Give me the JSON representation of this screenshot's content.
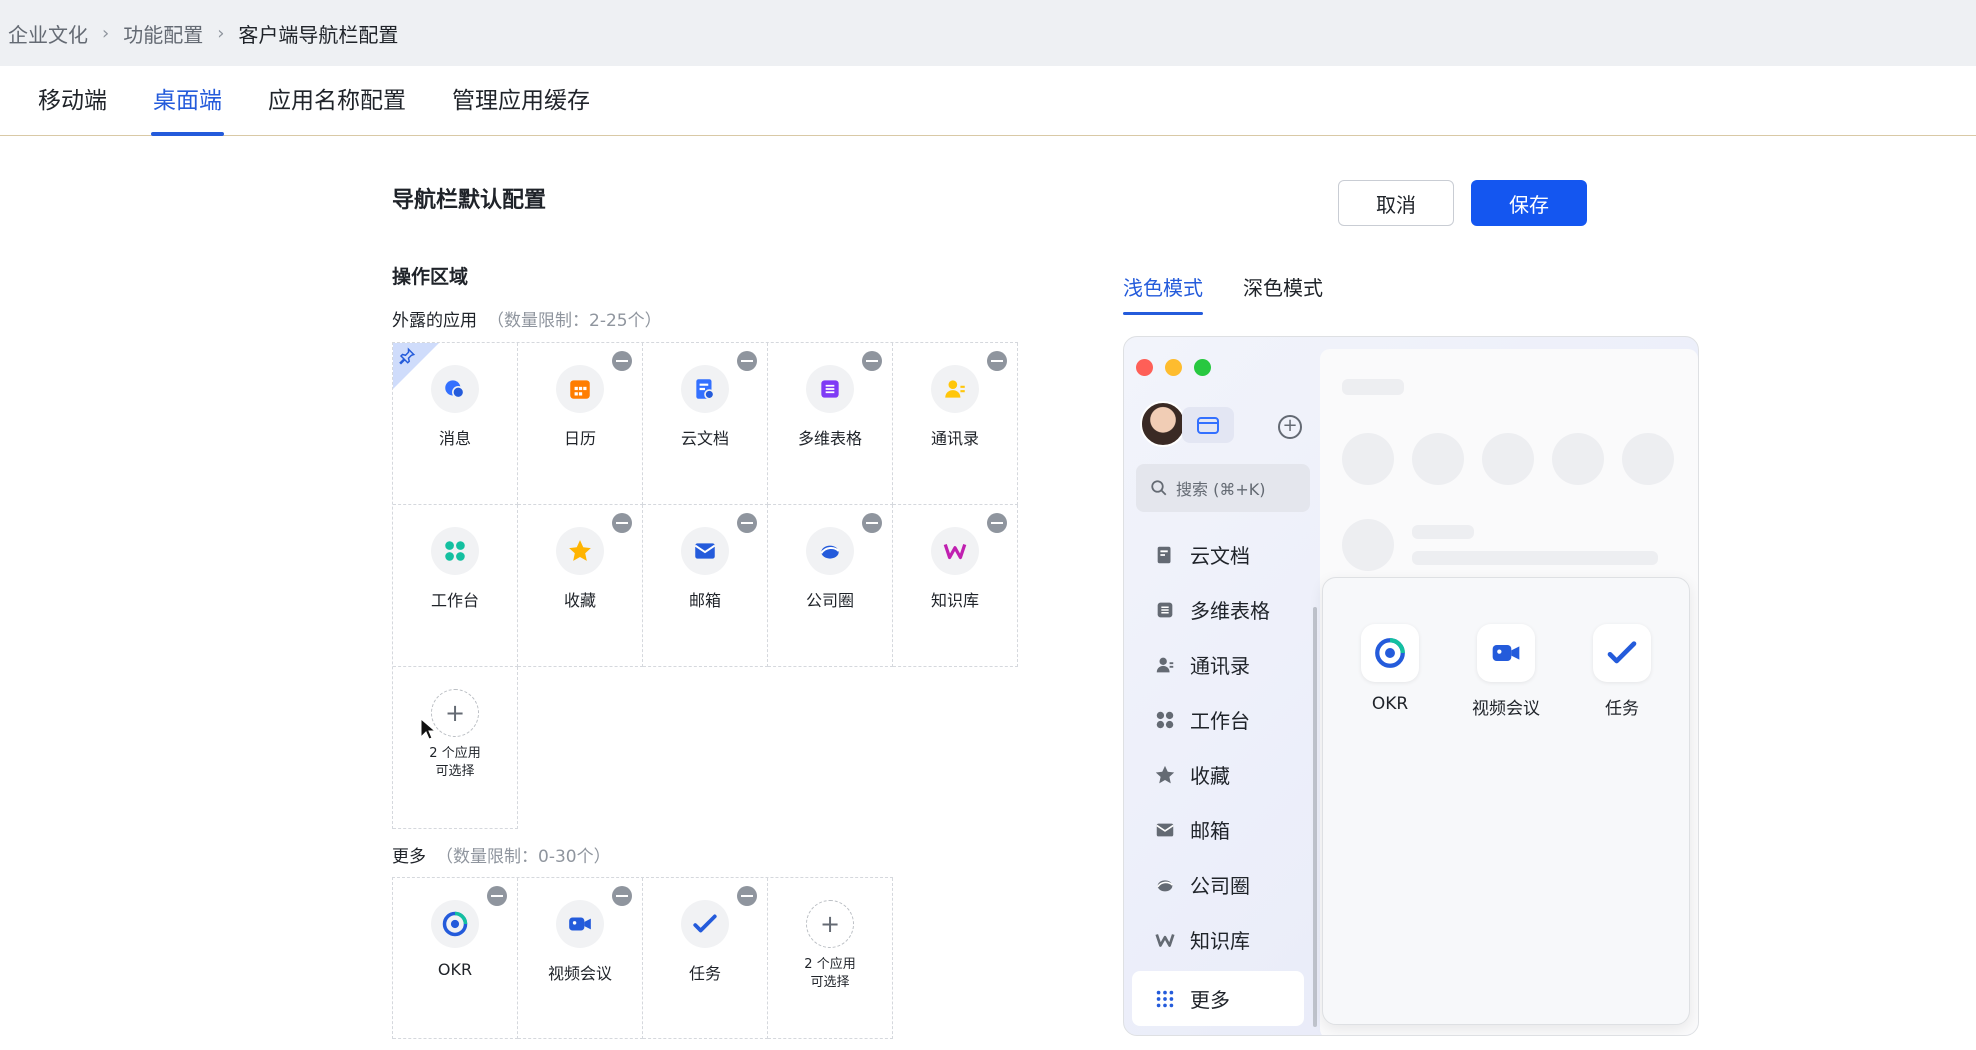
{
  "breadcrumb": {
    "items": [
      "企业文化",
      "功能配置",
      "客户端导航栏配置"
    ]
  },
  "tabs": [
    "移动端",
    "桌面端",
    "应用名称配置",
    "管理应用缓存"
  ],
  "page": {
    "title": "导航栏默认配置",
    "cancel": "取消",
    "save": "保存",
    "section": "操作区域"
  },
  "exposed": {
    "label": "外露的应用",
    "limit": "（数量限制：2-25个）",
    "apps": [
      {
        "name": "消息",
        "icon": "message-icon"
      },
      {
        "name": "日历",
        "icon": "calendar-icon"
      },
      {
        "name": "云文档",
        "icon": "doc-icon"
      },
      {
        "name": "多维表格",
        "icon": "base-table-icon"
      },
      {
        "name": "通讯录",
        "icon": "contacts-icon"
      },
      {
        "name": "工作台",
        "icon": "workplace-icon"
      },
      {
        "name": "收藏",
        "icon": "star-icon"
      },
      {
        "name": "邮箱",
        "icon": "mail-icon"
      },
      {
        "name": "公司圈",
        "icon": "moments-icon"
      },
      {
        "name": "知识库",
        "icon": "wiki-icon"
      }
    ],
    "add_label": "2 个应用\n可选择"
  },
  "more": {
    "label": "更多",
    "limit": "（数量限制：0-30个）",
    "apps": [
      {
        "name": "OKR",
        "icon": "okr-icon"
      },
      {
        "name": "视频会议",
        "icon": "video-icon"
      },
      {
        "name": "任务",
        "icon": "task-icon"
      }
    ],
    "add_label": "2 个应用\n可选择"
  },
  "modes": [
    "浅色模式",
    "深色模式"
  ],
  "preview": {
    "search": "搜索 (⌘+K)",
    "nav": [
      "云文档",
      "多维表格",
      "通讯录",
      "工作台",
      "收藏",
      "邮箱",
      "公司圈",
      "知识库"
    ],
    "more": "更多",
    "popup_apps": [
      "OKR",
      "视频会议",
      "任务"
    ]
  },
  "colors": {
    "accent": "#245bdb",
    "primary_button": "#1456f0"
  }
}
